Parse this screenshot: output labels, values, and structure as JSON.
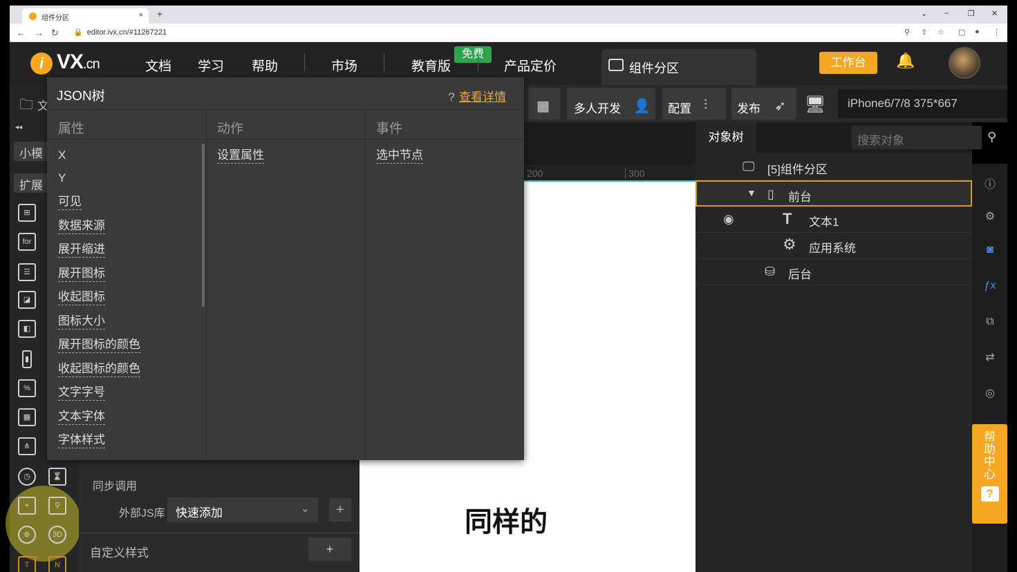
{
  "browser": {
    "tab_title": "组件分区",
    "url": "editor.ivx.cn/#11267221",
    "new_tab": "+",
    "tab_close": "×"
  },
  "topbar": {
    "logo_main": "VX",
    "logo_suffix": ".cn",
    "logo_letter": "i",
    "nav": [
      "文档",
      "学习",
      "帮助",
      "市场",
      "教育版",
      "产品定价"
    ],
    "free_badge": "免费",
    "active_tab": "组件分区",
    "workbench": "工作台"
  },
  "toolbar": {
    "multi_dev": "多人开发",
    "config": "配置",
    "publish": "发布",
    "device": "iPhone6/7/8 375*667"
  },
  "left_rail": {
    "chip_small": "小模",
    "chip_ext": "扩展",
    "collapse": "◂◂",
    "file_label": "文"
  },
  "json_popup": {
    "title": "JSON树",
    "help_link": "查看详情",
    "columns": {
      "props": "属性",
      "actions": "动作",
      "events": "事件"
    },
    "properties": [
      "X",
      "Y",
      "可见",
      "数据来源",
      "展开缩进",
      "展开图标",
      "收起图标",
      "图标大小",
      "展开图标的颜色",
      "收起图标的颜色",
      "文字字号",
      "文本字体",
      "字体样式"
    ],
    "actions": [
      "设置属性"
    ],
    "events": [
      "选中节点"
    ]
  },
  "prop_panel": {
    "sync_call": "同步调用",
    "ext_js_label": "外部JS库",
    "ext_js_value": "快速添加",
    "custom_style": "自定义样式",
    "plus": "+"
  },
  "canvas": {
    "ruler_marks": [
      "200",
      "300"
    ],
    "text": "同样的"
  },
  "object_tree": {
    "tab": "对象树",
    "search_placeholder": "搜索对象",
    "nodes": [
      "[5]组件分区",
      "前台",
      "文本1",
      "应用系统",
      "后台"
    ]
  },
  "help_center": {
    "label": "帮助中心",
    "q": "?"
  },
  "colors": {
    "accent": "#f5a623",
    "free_green": "#2ea44f",
    "selection": "#d99a1e",
    "canvas_border": "#29c0c9"
  }
}
